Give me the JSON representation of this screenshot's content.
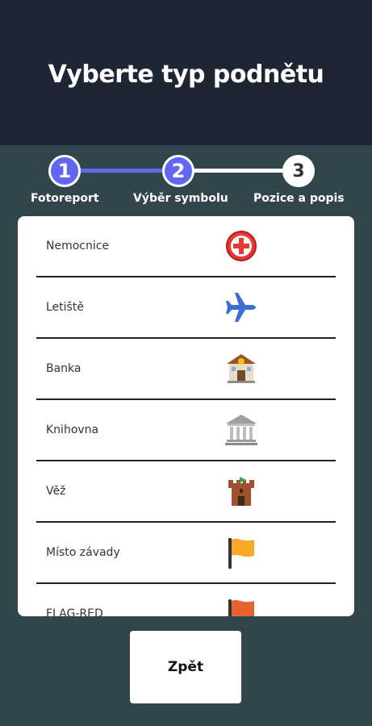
{
  "header": {
    "title": "Vyberte typ podnětu"
  },
  "stepper": {
    "steps": [
      {
        "number": "1",
        "label": "Fotoreport",
        "state": "completed"
      },
      {
        "number": "2",
        "label": "Výběr symbolu",
        "state": "active"
      },
      {
        "number": "3",
        "label": "Pozice a popis",
        "state": "pending"
      }
    ]
  },
  "symbols": {
    "items": [
      {
        "label": "Nemocnice",
        "icon": "hospital-icon"
      },
      {
        "label": "Letiště",
        "icon": "airplane-icon"
      },
      {
        "label": "Banka",
        "icon": "bank-icon"
      },
      {
        "label": "Knihovna",
        "icon": "library-icon"
      },
      {
        "label": "Věž",
        "icon": "tower-icon"
      },
      {
        "label": "Místo závady",
        "icon": "yellow-flag-icon"
      },
      {
        "label": "FLAG-RED",
        "icon": "red-flag-icon"
      }
    ]
  },
  "footer": {
    "back_label": "Zpět"
  },
  "colors": {
    "accent": "#6366f1",
    "header_bg": "#1e2634",
    "page_bg": "#32444c"
  }
}
